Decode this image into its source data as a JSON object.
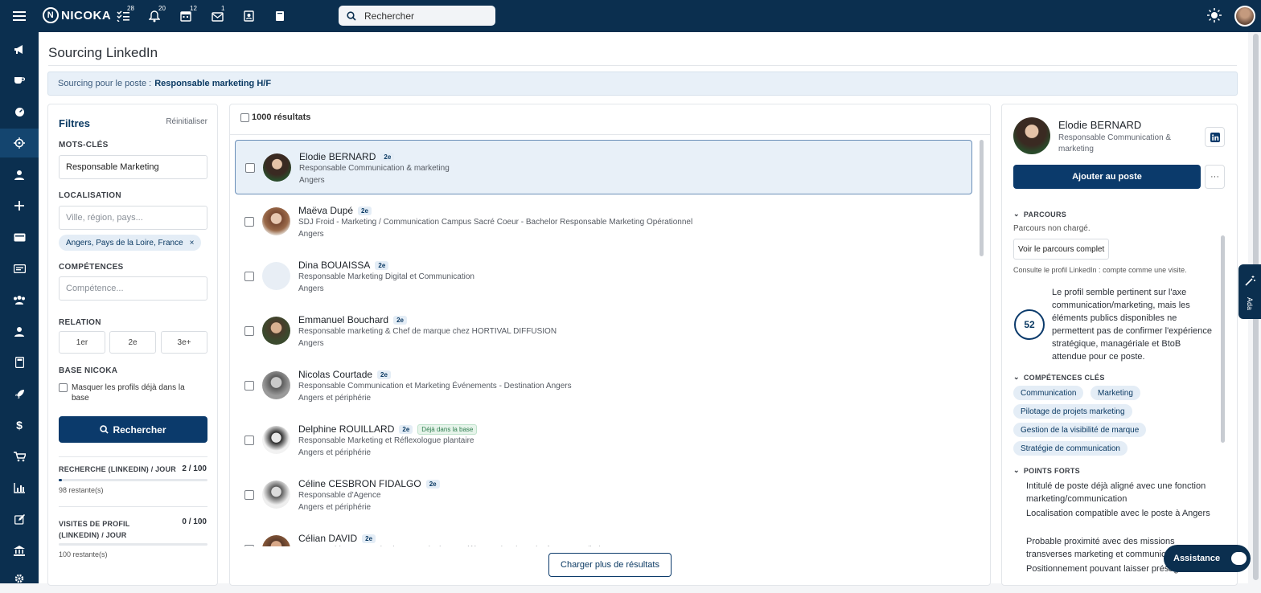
{
  "topbar": {
    "logo_text": "NICOKA",
    "search_placeholder": "Rechercher",
    "badges": {
      "tasks": "28",
      "notifications": "20",
      "calendar": "12",
      "messages": "1"
    }
  },
  "page": {
    "title": "Sourcing LinkedIn",
    "banner_prefix": "Sourcing pour le poste :",
    "banner_job": "Responsable marketing H/F"
  },
  "filters": {
    "title": "Filtres",
    "reset": "Réinitialiser",
    "keywords_label": "MOTS-CLÉS",
    "keywords_value": "Responsable Marketing",
    "location_label": "LOCALISATION",
    "location_placeholder": "Ville, région, pays...",
    "location_chip": "Angers, Pays de la Loire, France",
    "skills_label": "COMPÉTENCES",
    "skills_placeholder": "Compétence...",
    "relation_label": "RELATION",
    "relation_options": [
      "1er",
      "2e",
      "3e+"
    ],
    "base_label": "BASE NICOKA",
    "hide_in_base": "Masquer les profils déjà dans la base",
    "search_button": "Rechercher",
    "quota_search_label": "RECHERCHE (LINKEDIN) / JOUR",
    "quota_search_value": "2 / 100",
    "quota_search_fraction": 0.02,
    "quota_search_rest": "98 restante(s)",
    "quota_visits_label": "VISITES DE PROFIL (LINKEDIN) / JOUR",
    "quota_visits_value": "0 / 100",
    "quota_visits_fraction": 0,
    "quota_visits_rest": "100 restante(s)"
  },
  "results": {
    "count": "1000 résultats",
    "load_more": "Charger plus de résultats",
    "in_base_label": "Déjà dans la base",
    "rows": [
      {
        "name": "Elodie BERNARD",
        "degree": "2e",
        "job": "Responsable Communication & marketing",
        "location": "Angers"
      },
      {
        "name": "Maëva Dupé",
        "degree": "2e",
        "job": "SDJ Froid - Marketing / Communication Campus Sacré Coeur - Bachelor Responsable Marketing Opérationnel",
        "location": "Angers"
      },
      {
        "name": "Dina BOUAISSA",
        "degree": "2e",
        "job": "Responsable Marketing Digital et Communication",
        "location": "Angers"
      },
      {
        "name": "Emmanuel Bouchard",
        "degree": "2e",
        "job": "Responsable marketing & Chef de marque chez HORTIVAL DIFFUSION",
        "location": "Angers"
      },
      {
        "name": "Nicolas Courtade",
        "degree": "2e",
        "job": "Responsable Communication et Marketing Événements - Destination Angers",
        "location": "Angers et périphérie"
      },
      {
        "name": "Delphine ROUILLARD",
        "degree": "2e",
        "job": "Responsable Marketing et Réflexologue plantaire",
        "location": "Angers et périphérie"
      },
      {
        "name": "Céline CESBRON FIDALGO",
        "degree": "2e",
        "job": "Responsable d'Agence",
        "location": "Angers et périphérie"
      },
      {
        "name": "Célian DAVID",
        "degree": "2e",
        "job": "Responsable Communication et Marketing & Référent Print chez Akrofon Le Potellerie",
        "location": ""
      }
    ]
  },
  "detail": {
    "name": "Elodie BERNARD",
    "job": "Responsable Communication & marketing",
    "add_button": "Ajouter au poste",
    "more_button": "···",
    "parcours_title": "PARCOURS",
    "parcours_status": "Parcours non chargé.",
    "parcours_button": "Voir le parcours complet",
    "parcours_note": "Consulte le profil LinkedIn : compte comme une visite.",
    "score": "52",
    "summary": "Le profil semble pertinent sur l'axe communication/marketing, mais les éléments publics disponibles ne permettent pas de confirmer l'expérience stratégique, managériale et BtoB attendue pour ce poste.",
    "skills_title": "COMPÉTENCES CLÉS",
    "skills": [
      "Communication",
      "Marketing",
      "Pilotage de projets marketing",
      "Gestion de la visibilité de marque",
      "Stratégie de communication"
    ],
    "strengths_title": "POINTS FORTS",
    "strengths": [
      "Intitulé de poste déjà aligné avec une fonction marketing/communication",
      "Localisation compatible avec le poste à Angers",
      "Probable proximité avec des missions transverses marketing et communication",
      "Positionnement pouvant laisser présager"
    ]
  },
  "widgets": {
    "ada_label": "Ada",
    "assistance": "Assistance"
  }
}
